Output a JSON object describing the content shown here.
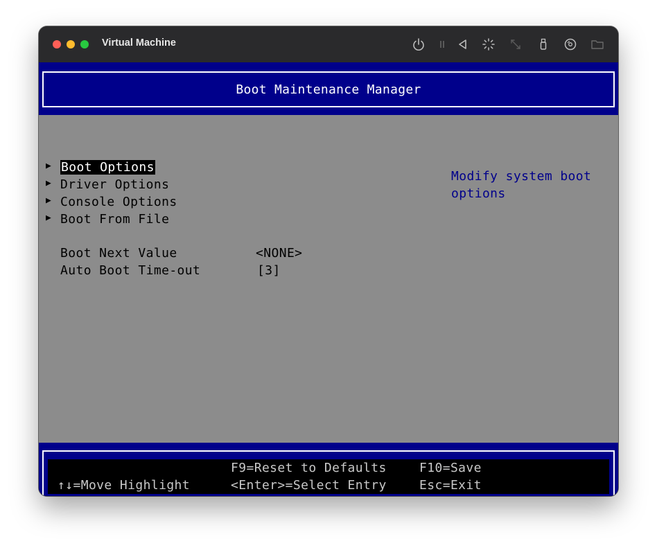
{
  "window": {
    "title": "Virtual Machine",
    "toolbar_icons": [
      "power-icon",
      "pause-icon",
      "back-icon",
      "brightness-icon",
      "resize-icon",
      "usb-icon",
      "disc-icon",
      "folder-icon"
    ]
  },
  "bios": {
    "header_title": "Boot Maintenance Manager",
    "menu": [
      {
        "label": "Boot Options",
        "selected": true
      },
      {
        "label": "Driver Options",
        "selected": false
      },
      {
        "label": "Console Options",
        "selected": false
      },
      {
        "label": "Boot From File",
        "selected": false
      }
    ],
    "fields": [
      {
        "label": "Boot Next Value",
        "value": "<NONE>"
      },
      {
        "label": "Auto Boot Time-out",
        "value": "[3]"
      }
    ],
    "help_text_line1": "Modify system boot",
    "help_text_line2": "options",
    "footer": {
      "move_highlight": "↑↓=Move Highlight",
      "reset_defaults": "F9=Reset to Defaults",
      "select_entry": "<Enter>=Select Entry",
      "save": "F10=Save",
      "exit": "Esc=Exit"
    }
  },
  "colors": {
    "header_blue": "#00008b",
    "body_gray": "#8c8c8c",
    "help_blue": "#00008b"
  }
}
